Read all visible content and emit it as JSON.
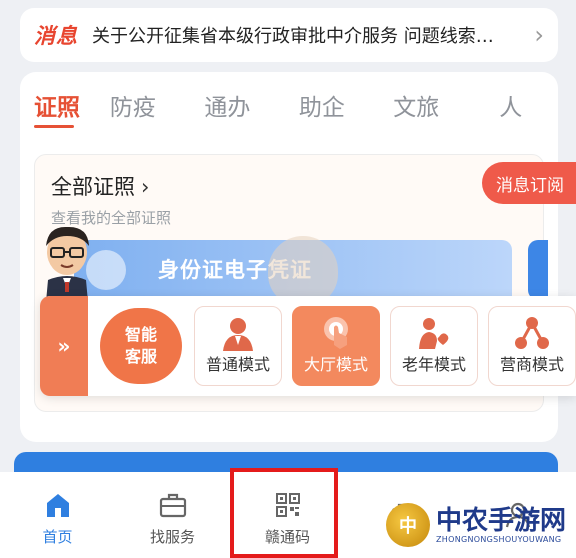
{
  "notice": {
    "tag": "消息",
    "text": "关于公开征集省本级行政审批中介服务 问题线索…"
  },
  "tabs": [
    {
      "label": "证照",
      "active": true
    },
    {
      "label": "防疫",
      "active": false
    },
    {
      "label": "通办",
      "active": false
    },
    {
      "label": "助企",
      "active": false
    },
    {
      "label": "文旅",
      "active": false
    },
    {
      "label": "人",
      "active": false
    }
  ],
  "certs": {
    "title": "全部证照",
    "subtitle": "查看我的全部证照",
    "subscribe_button": "消息订阅",
    "id_card_label": "身份证电子凭证"
  },
  "modes": {
    "ai_line1": "智能",
    "ai_line2": "客服",
    "items": [
      {
        "label": "普通模式",
        "icon": "person-icon",
        "active": false
      },
      {
        "label": "大厅模式",
        "icon": "touch-icon",
        "active": true
      },
      {
        "label": "老年模式",
        "icon": "elder-icon",
        "active": false
      },
      {
        "label": "营商模式",
        "icon": "network-icon",
        "active": false
      }
    ]
  },
  "bottom_nav": [
    {
      "label": "首页",
      "icon": "home-icon",
      "active": true
    },
    {
      "label": "找服务",
      "icon": "briefcase-icon",
      "active": false
    },
    {
      "label": "赣通码",
      "icon": "qr-code-icon",
      "active": false
    },
    {
      "label": "",
      "icon": "bag-icon",
      "active": false
    },
    {
      "label": "",
      "icon": "user-icon",
      "active": false
    }
  ],
  "watermark": {
    "title": "中农手游网",
    "sub": "ZHONGNONGSHOUYOUWANG"
  },
  "colors": {
    "accent": "#e65135",
    "primary_blue": "#2f7fe0",
    "highlight_red": "#e41b1b"
  }
}
